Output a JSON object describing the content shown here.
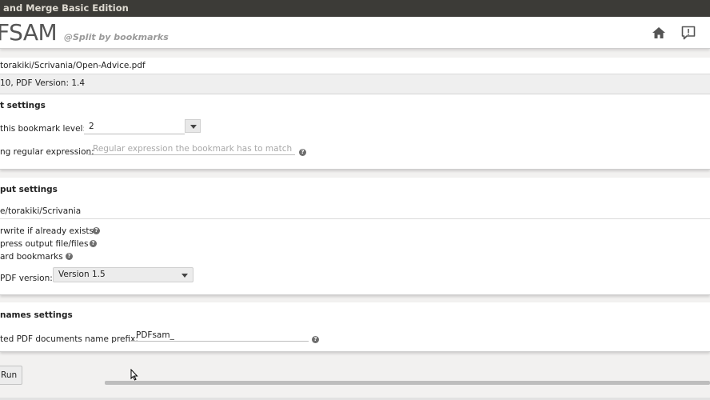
{
  "window": {
    "title": "and Merge Basic Edition"
  },
  "header": {
    "logo": "FSAM",
    "module_title": "@Split by bookmarks",
    "home_icon": "home-icon",
    "feedback_icon": "feedback-icon"
  },
  "input": {
    "path": "torakiki/Scrivania/Open-Advice.pdf",
    "info": "10, PDF Version: 1.4"
  },
  "split_settings": {
    "title": "t settings",
    "level_label": "this bookmark level:",
    "level_value": "2",
    "regex_label": "ng regular expression:",
    "regex_placeholder": "Regular expression the bookmark has to match"
  },
  "output_settings": {
    "title": "put settings",
    "directory": "e/torakiki/Scrivania",
    "overwrite_label": "rwrite if already exists",
    "compress_label": "press output file/files",
    "discard_label": "ard bookmarks",
    "pdf_version_label": "PDF version:",
    "pdf_version_value": "Version 1.5"
  },
  "names_settings": {
    "title": "names settings",
    "prefix_label": "ted PDF documents name prefix:",
    "prefix_value": "PDFsam_"
  },
  "footer": {
    "run_label": "Run"
  }
}
